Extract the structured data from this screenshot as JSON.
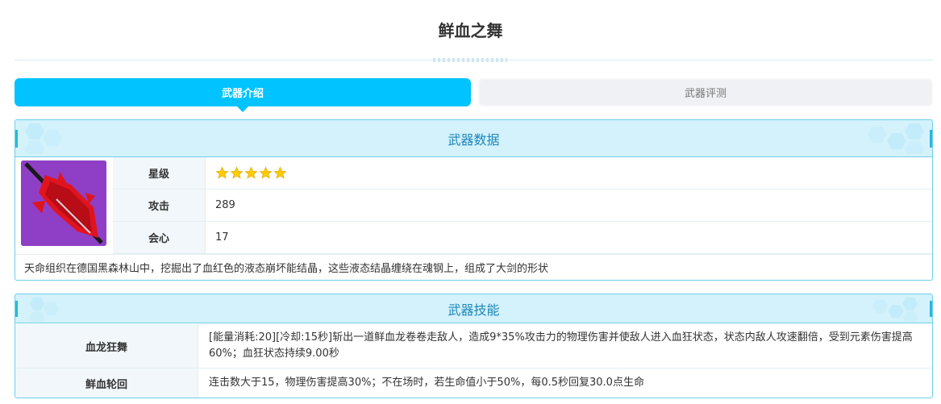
{
  "page": {
    "title": "鲜血之舞"
  },
  "tabs": [
    {
      "label": "武器介绍",
      "active": true
    },
    {
      "label": "武器评测",
      "active": false
    }
  ],
  "weapon_data": {
    "header": "武器数据",
    "image_icon": "weapon-greatsword-icon",
    "rows": [
      {
        "label": "星级",
        "stars": 5
      },
      {
        "label": "攻击",
        "value": "289"
      },
      {
        "label": "会心",
        "value": "17"
      }
    ],
    "description": "天命组织在德国黑森林山中，挖掘出了血红色的液态崩坏能结晶，这些液态结晶缠绕在魂钢上，组成了大剑的形状"
  },
  "skills": {
    "header": "武器技能",
    "items": [
      {
        "name": "血龙狂舞",
        "desc": "[能量消耗:20][冷却:15秒]斩出一道鲜血龙卷卷走敌人，造成9*35%攻击力的物理伤害并使敌人进入血狂状态，状态内敌人攻速翻倍，受到元素伤害提高60%；血狂状态持续9.00秒"
      },
      {
        "name": "鲜血轮回",
        "desc": "连击数大于15，物理伤害提高30%；不在场时，若生命值小于50%，每0.5秒回复30.0点生命"
      }
    ]
  },
  "colors": {
    "accent": "#00c3ff",
    "header_bg": "#d3f2fc",
    "header_text": "#1d86b9",
    "star": "#ffcc00"
  }
}
